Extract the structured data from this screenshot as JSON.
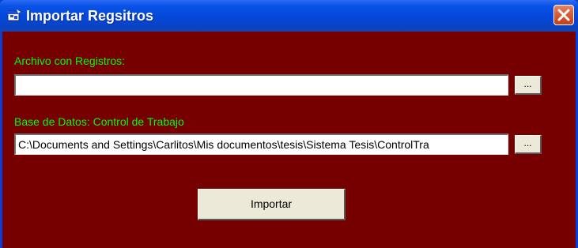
{
  "window": {
    "title": "Importar Regsitros"
  },
  "form": {
    "archivo_label": "Archivo con Registros:",
    "archivo_value": "",
    "archivo_browse_label": "...",
    "base_label": "Base de Datos: Control de Trabajo",
    "base_value": "C:\\Documents and Settings\\Carlitos\\Mis documentos\\tesis\\Sistema Tesis\\ControlTra",
    "base_browse_label": "...",
    "importar_label": "Importar"
  },
  "icons": {
    "app": "window-app-icon",
    "close": "close-icon"
  },
  "colors": {
    "client_background": "#760000",
    "label_text": "#00ff00",
    "titlebar": "#0346d8",
    "close_button": "#d95b37"
  }
}
